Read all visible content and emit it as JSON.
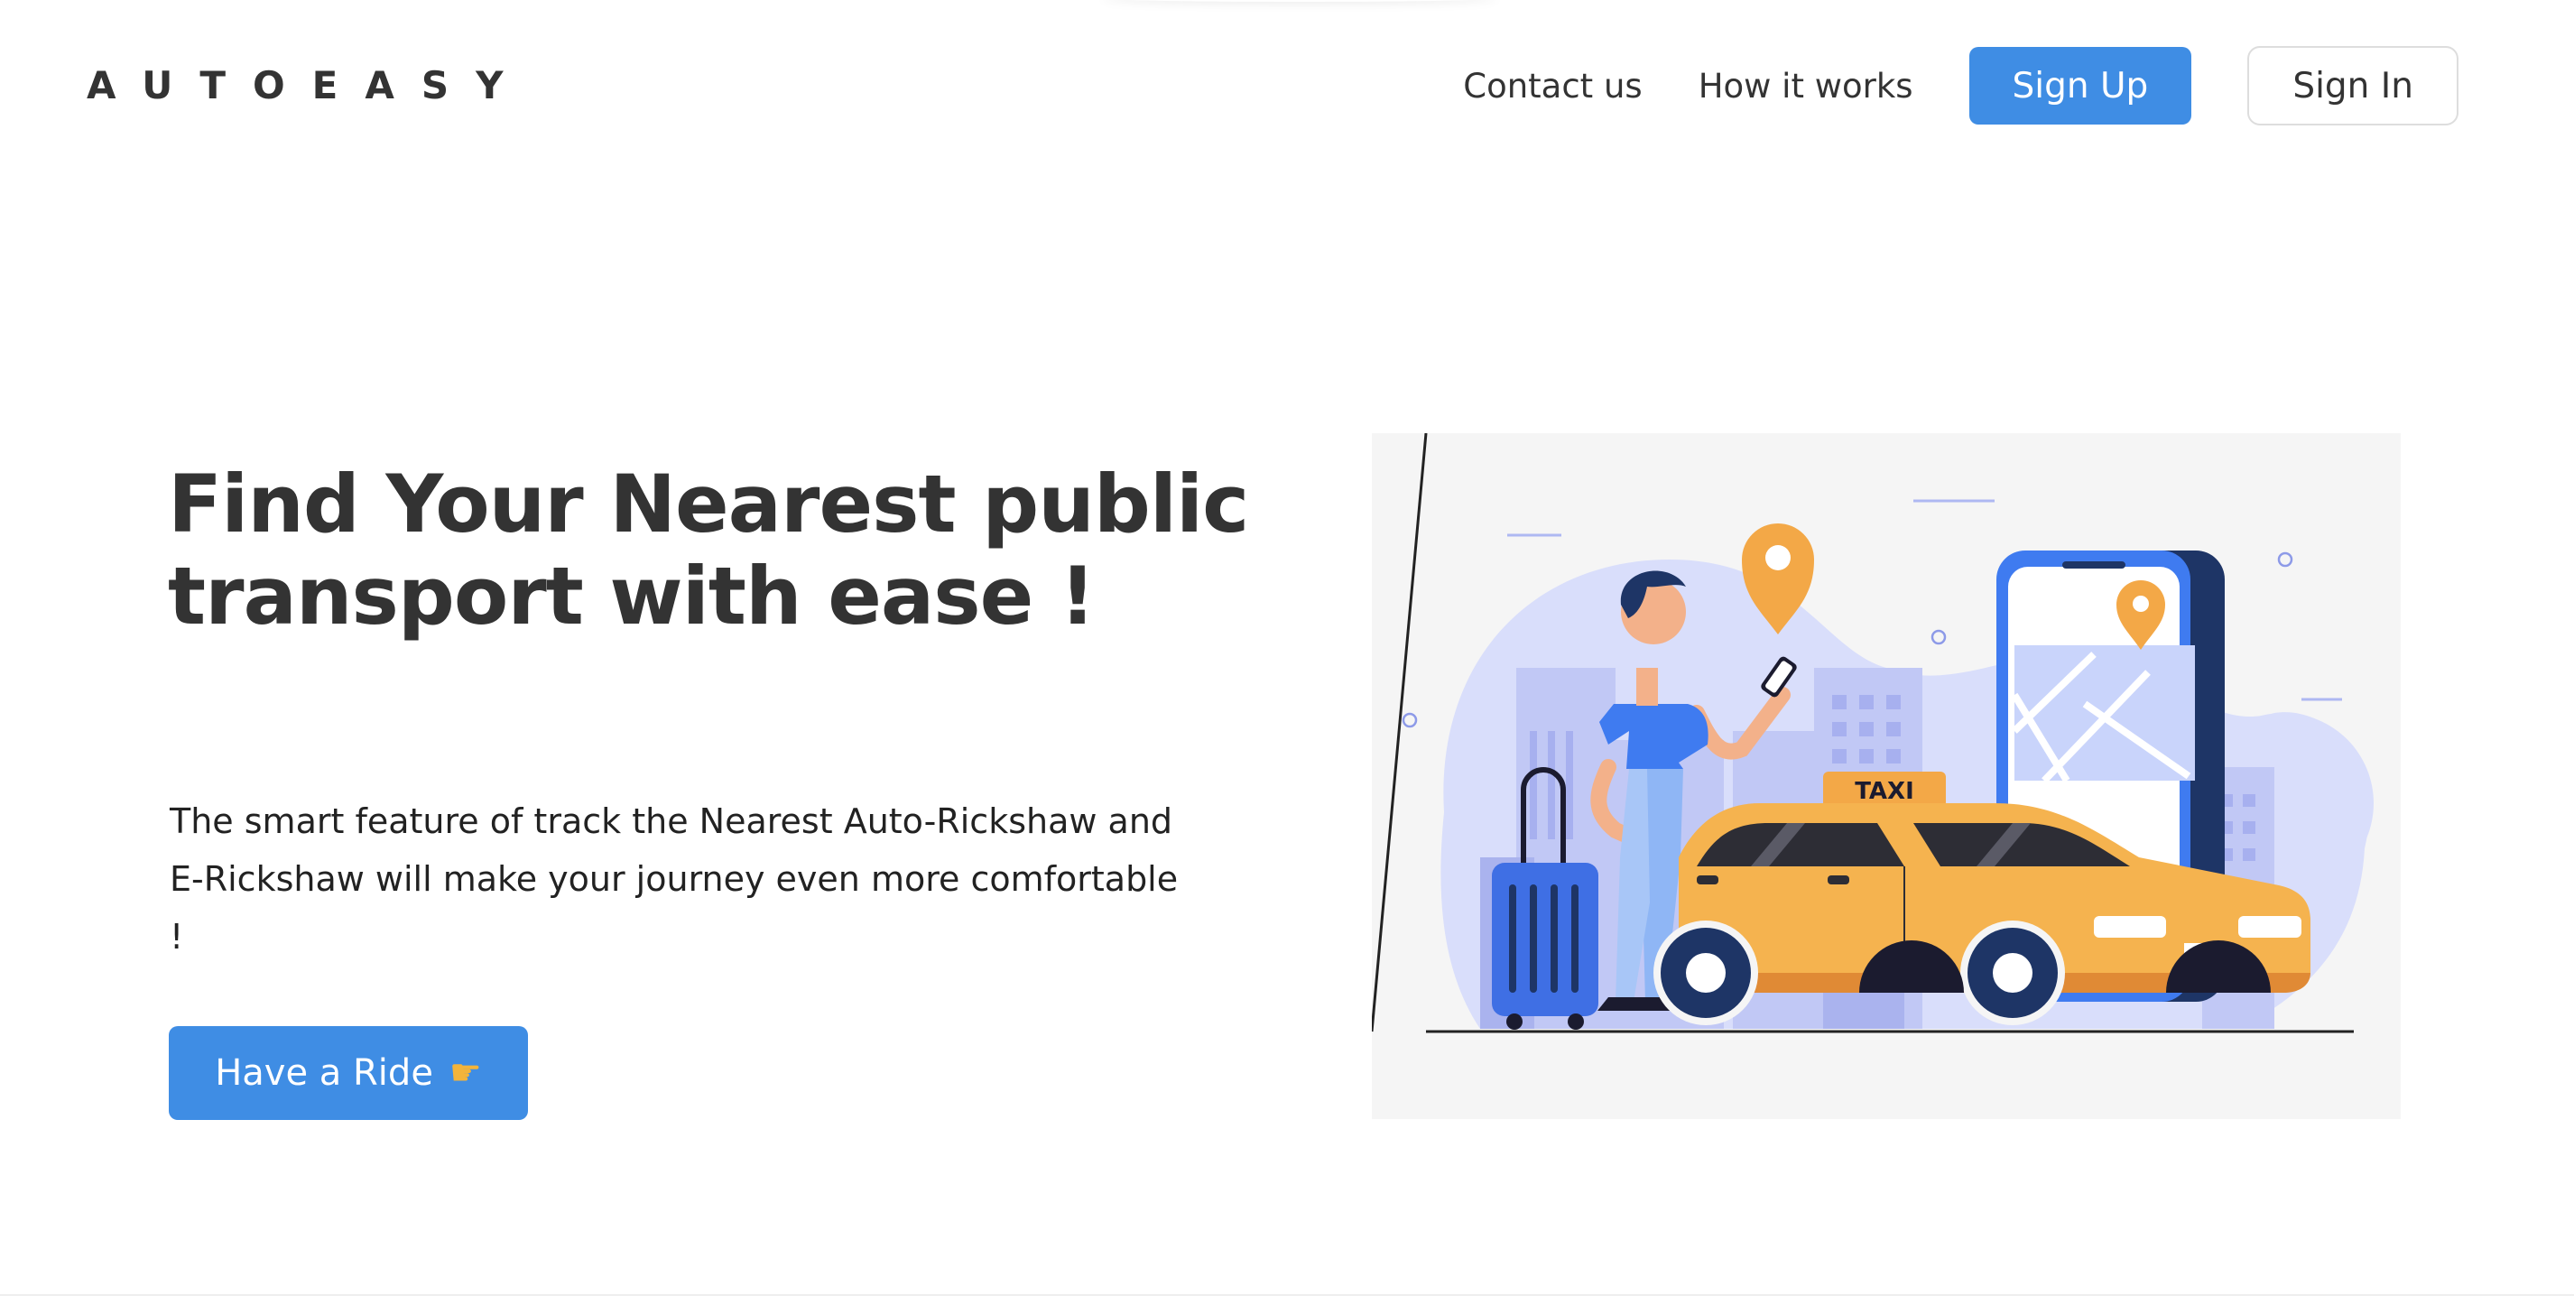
{
  "header": {
    "logo": "AUTOEASY",
    "nav": {
      "contact": "Contact us",
      "how_it_works": "How it works",
      "sign_up": "Sign Up",
      "sign_in": "Sign In"
    }
  },
  "hero": {
    "title": "Find Your Nearest public transport with ease !",
    "description": "The smart feature of track the Nearest Auto-Rickshaw and E-Rickshaw will make your journey even more comfortable !",
    "cta_label": "Have a Ride",
    "cta_icon": "pointing-hand-icon"
  },
  "illustration": {
    "taxi_sign": "TAXI"
  },
  "colors": {
    "accent": "#3f8de4",
    "text": "#333333",
    "taxi": "#f5b34f",
    "navy": "#1e3566"
  }
}
